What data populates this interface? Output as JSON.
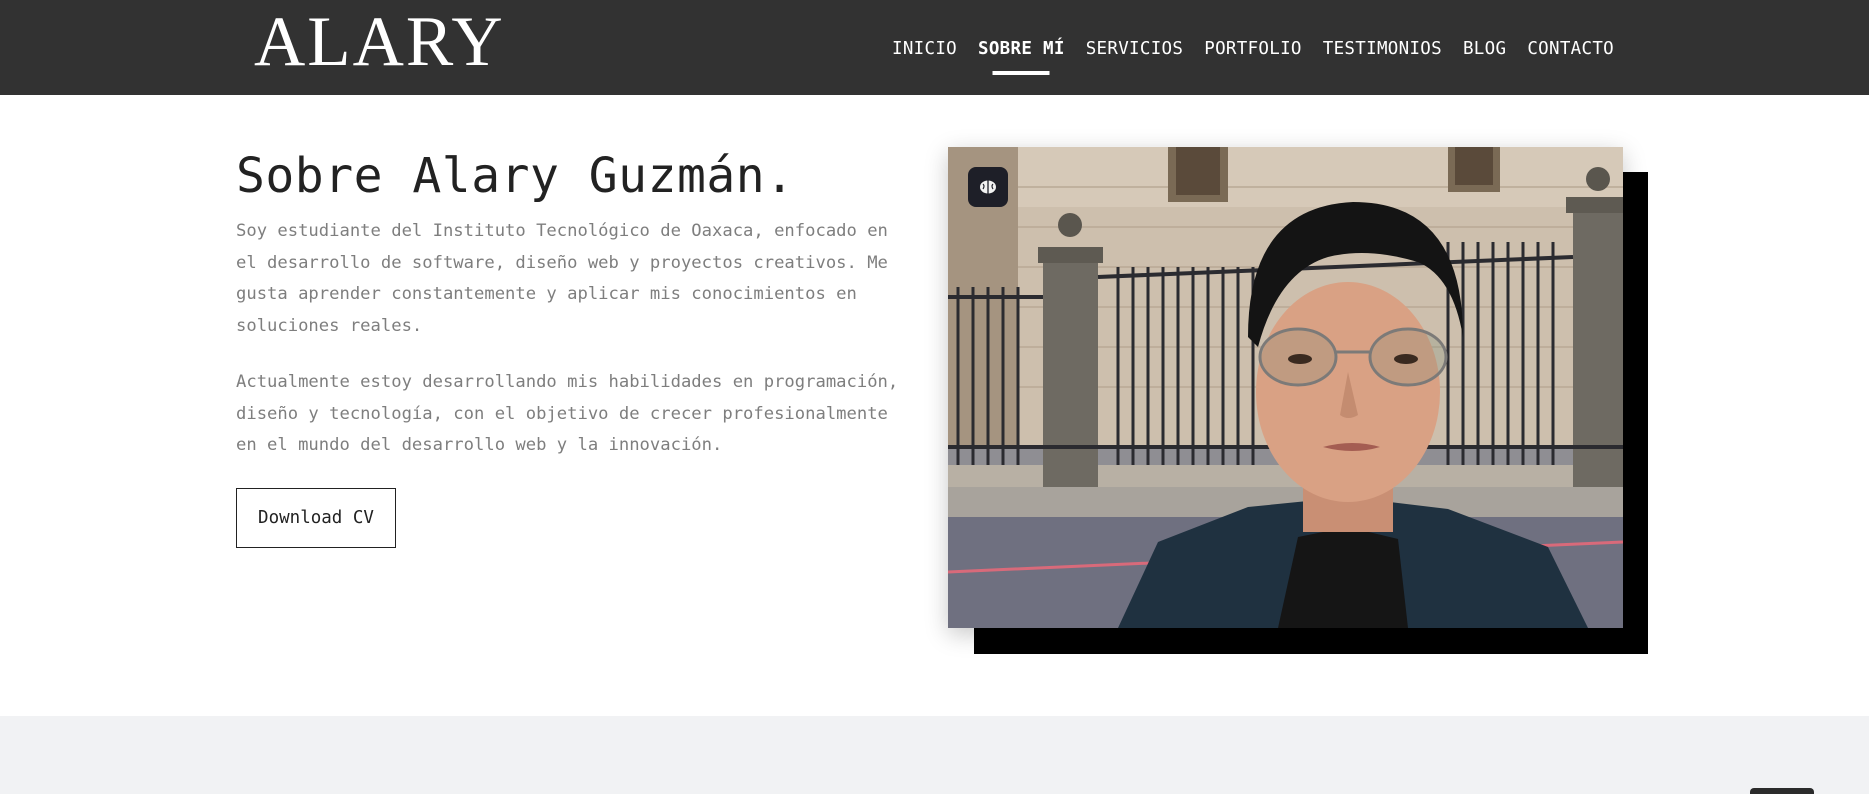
{
  "header": {
    "logo": "ALARY",
    "nav": [
      {
        "label": "INICIO",
        "active": false
      },
      {
        "label": "SOBRE MÍ",
        "active": true
      },
      {
        "label": "SERVICIOS",
        "active": false
      },
      {
        "label": "PORTFOLIO",
        "active": false
      },
      {
        "label": "TESTIMONIOS",
        "active": false
      },
      {
        "label": "BLOG",
        "active": false
      },
      {
        "label": "CONTACTO",
        "active": false
      }
    ]
  },
  "about": {
    "title": "Sobre Alary Guzmán.",
    "paragraph_1": "Soy estudiante del Instituto Tecnológico de Oaxaca, enfocado en el desarrollo de software, diseño web y proyectos creativos. Me gusta aprender constantemente y aplicar mis conocimientos en soluciones reales.",
    "paragraph_2": "Actualmente estoy desarrollando mis habilidades en programación, diseño y tecnología, con el objetivo de crecer profesionalmente en el mundo del desarrollo web y la innovación.",
    "cv_button": "Download CV"
  },
  "photo": {
    "badge_icon": "brain-icon"
  },
  "colors": {
    "header_bg": "#323232",
    "text_dark": "#222222",
    "text_muted": "#7e7e7e",
    "band_bg": "#f1f2f4"
  }
}
